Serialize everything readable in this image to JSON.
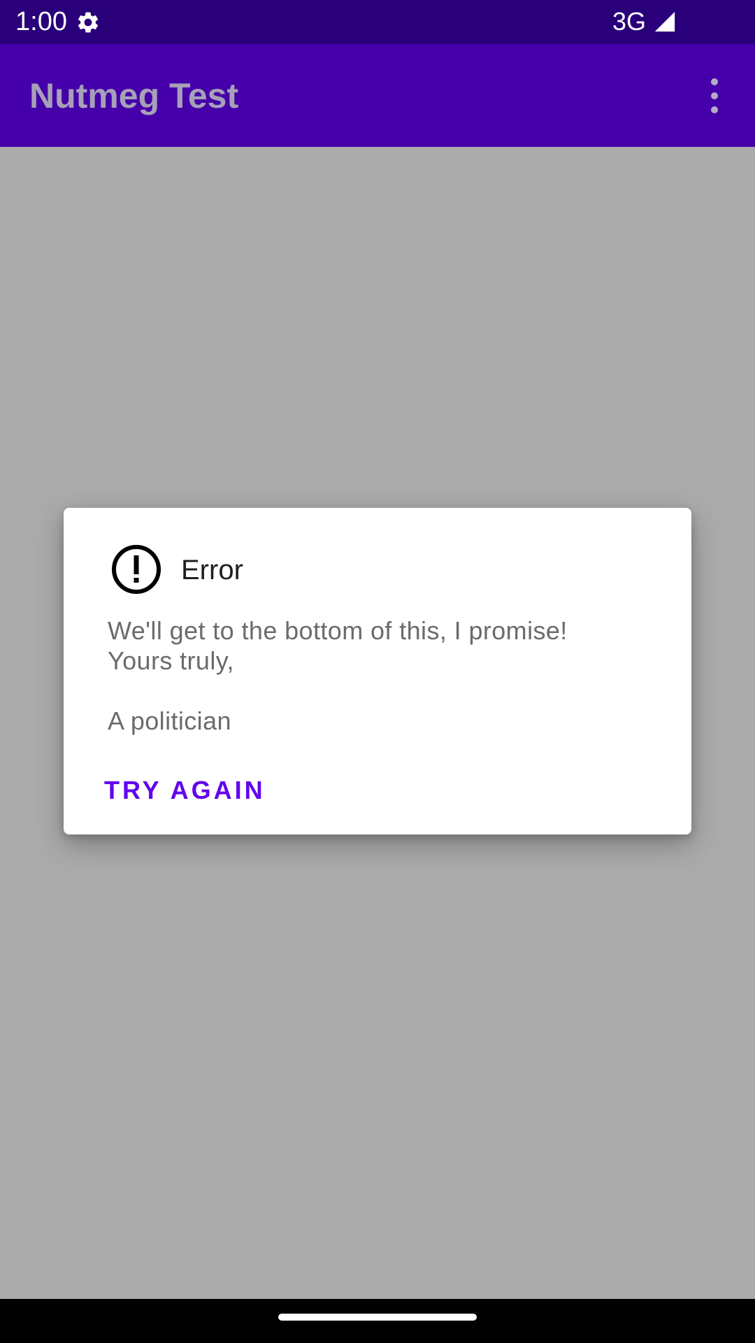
{
  "status_bar": {
    "time": "1:00",
    "network": "3G",
    "settings_icon": "gear-icon",
    "signal_icon": "cell-signal-icon"
  },
  "app_bar": {
    "title": "Nutmeg Test",
    "overflow_icon": "more-vert-icon"
  },
  "dialog": {
    "icon": "error-exclamation-icon",
    "title": "Error",
    "message_lines": [
      "We'll get to the bottom of this, I promise!",
      "Yours truly,",
      "",
      "A politician"
    ],
    "button_label": "TRY AGAIN"
  },
  "colors": {
    "status_bar": "#290079",
    "app_bar": "#4500a9",
    "scrim_background": "#ababab",
    "accent": "#6200ee",
    "nav_bar": "#000000"
  }
}
